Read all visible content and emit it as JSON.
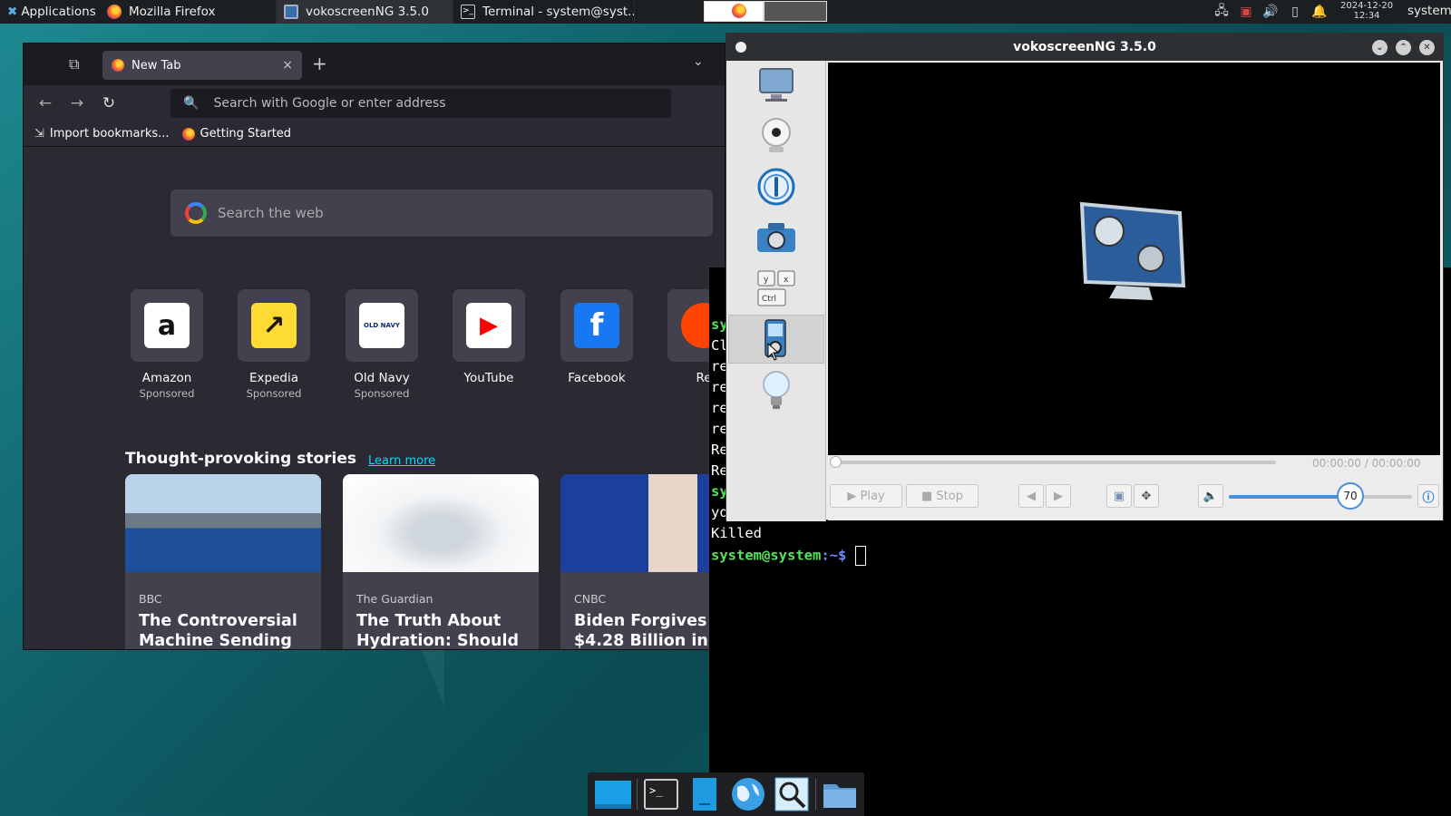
{
  "panel": {
    "apps": "Applications ⋮",
    "tasks": [
      {
        "label": "Mozilla Firefox"
      },
      {
        "label": "vokoscreenNG 3.5.0"
      },
      {
        "label": "Terminal - system@syst..."
      }
    ],
    "clock_date": "2024-12-20",
    "clock_time": "12:34",
    "user": "system"
  },
  "firefox": {
    "tab_title": "New Tab",
    "address_placeholder": "Search with Google or enter address",
    "bookmarks": [
      "Import bookmarks...",
      "Getting Started"
    ],
    "websearch_placeholder": "Search the web",
    "sites": [
      {
        "name": "Amazon",
        "sub": "Sponsored",
        "glyph": "a",
        "bg": "#ffffff",
        "fg": "#111111"
      },
      {
        "name": "Expedia",
        "sub": "Sponsored",
        "glyph": "↗",
        "bg": "#fddb32",
        "fg": "#1a1a1a"
      },
      {
        "name": "Old Navy",
        "sub": "Sponsored",
        "glyph": "OLD NAVY",
        "bg": "#ffffff",
        "fg": "#0b2c6b"
      },
      {
        "name": "YouTube",
        "sub": "",
        "glyph": "▶",
        "bg": "#ffffff",
        "fg": "#ff0000"
      },
      {
        "name": "Facebook",
        "sub": "",
        "glyph": "f",
        "bg": "#1877f2",
        "fg": "#ffffff"
      },
      {
        "name": "Re",
        "sub": "",
        "glyph": "",
        "bg": "#ff4500",
        "fg": "#ffffff"
      }
    ],
    "stories_heading": "Thought-provoking stories",
    "learn_more": "Learn more",
    "stories": [
      {
        "source": "BBC",
        "title": "The Controversial Machine Sending"
      },
      {
        "source": "The Guardian",
        "title": "The Truth About Hydration: Should"
      },
      {
        "source": "CNBC",
        "title": "Biden Forgives $4.28 Billion in"
      }
    ]
  },
  "terminal": {
    "partial_lines": [
      "sy",
      "Cl",
      "re",
      "re",
      "re",
      "re",
      "Re",
      "Re",
      "sy",
      "yo"
    ],
    "killed": "Killed",
    "prompt_user": "system@system",
    "prompt_path": ":~$ "
  },
  "voko": {
    "title": "vokoscreenNG 3.5.0",
    "time": "00:00:00 / 00:00:00",
    "play": "▶ Play",
    "stop": "■ Stop",
    "volume": "70",
    "side_icons": [
      "screen-icon",
      "webcam-icon",
      "info-circle-icon",
      "camera-icon",
      "keyboard-shortcut-icon",
      "player-icon",
      "lightbulb-icon"
    ]
  },
  "dock": {
    "items": [
      "desktop-icon",
      "terminal-icon",
      "files-icon",
      "browser-icon",
      "search-icon",
      "folder-icon"
    ]
  }
}
